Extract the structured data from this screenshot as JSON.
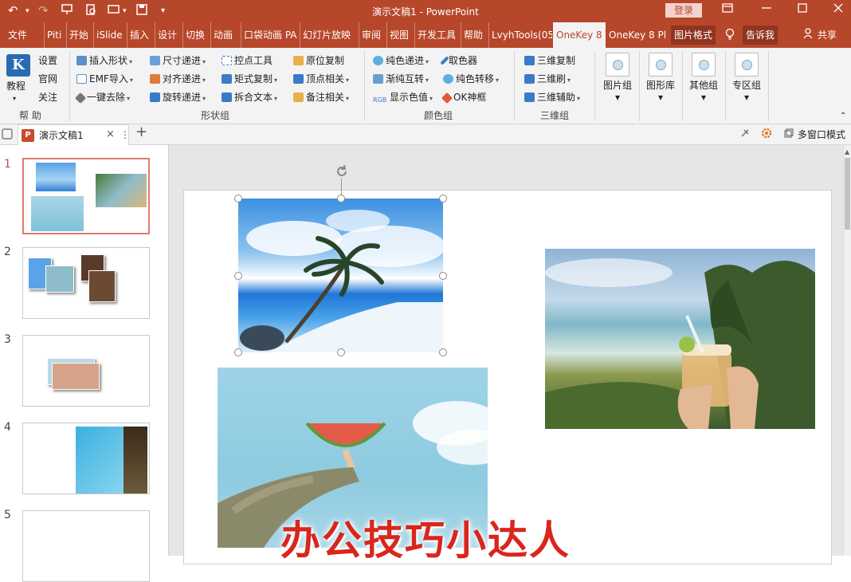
{
  "titlebar": {
    "title": "演示文稿1  -  PowerPoint",
    "login": "登录",
    "undo": "↶",
    "redo": "↷",
    "more": "▾"
  },
  "tabs": [
    {
      "label": "文件"
    },
    {
      "label": "Piti"
    },
    {
      "label": "开始"
    },
    {
      "label": "iSlide"
    },
    {
      "label": "插入"
    },
    {
      "label": "设计"
    },
    {
      "label": "切换"
    },
    {
      "label": "动画"
    },
    {
      "label": "口袋动画 PA"
    },
    {
      "label": "幻灯片放映"
    },
    {
      "label": "审阅"
    },
    {
      "label": "视图"
    },
    {
      "label": "开发工具"
    },
    {
      "label": "帮助"
    },
    {
      "label": "LvyhTools(05"
    },
    {
      "label": "OneKey 8"
    },
    {
      "label": "OneKey 8 Pl"
    },
    {
      "label": "图片格式"
    },
    {
      "label": "告诉我"
    },
    {
      "label": "共享"
    }
  ],
  "ribbon": {
    "help_group": {
      "jiaocheng": "教程",
      "shezhi": "设置",
      "guanwang": "官网",
      "guanzhu": "关注",
      "label": "帮 助"
    },
    "shape_group": {
      "items": [
        "插入形状",
        "EMF导入",
        "一键去除",
        "尺寸递进",
        "对齐递进",
        "旋转递进",
        "控点工具",
        "矩式复制",
        "拆合文本",
        "原位复制",
        "顶点相关",
        "备注相关"
      ],
      "label": "形状组"
    },
    "color_group": {
      "items": [
        "纯色递进",
        "渐纯互转",
        "显示色值",
        "取色器",
        "纯色转移",
        "OK神框"
      ],
      "label": "颜色组"
    },
    "threed_group": {
      "items": [
        "三维复制",
        "三维刷",
        "三维辅助"
      ],
      "label": "三维组"
    },
    "big_buttons": [
      "图片组",
      "图形库",
      "其他组",
      "专区组"
    ]
  },
  "docbar": {
    "tab_title": "演示文稿1",
    "add": "+",
    "multiwin": "多窗口模式"
  },
  "slides": [
    {
      "num": "1"
    },
    {
      "num": "2"
    },
    {
      "num": "3"
    },
    {
      "num": "4"
    },
    {
      "num": "5"
    }
  ],
  "watermark": "办公技巧小达人",
  "colors": {
    "accent": "#b7472a",
    "ribbon_bg": "#f3f3f3",
    "selection": "#e07a6a"
  }
}
